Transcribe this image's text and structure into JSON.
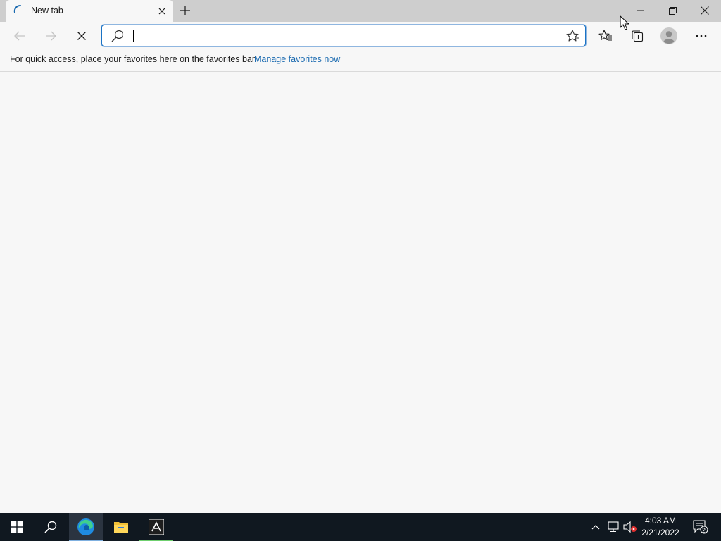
{
  "tab": {
    "title": "New tab",
    "close_icon": "close-icon",
    "favicon": "loading-spinner-icon"
  },
  "titlebar": {
    "new_tab_icon": "plus-icon",
    "minimize_icon": "minimize-icon",
    "restore_icon": "restore-icon",
    "close_icon": "close-icon"
  },
  "toolbar": {
    "back_icon": "back-arrow-icon",
    "forward_icon": "forward-arrow-icon",
    "stop_icon": "stop-icon",
    "address": {
      "value": "",
      "placeholder": ""
    },
    "favorite_icon": "star-icon",
    "favorites_icon": "favorites-icon",
    "collections_icon": "collections-icon",
    "profile_icon": "profile-avatar-icon",
    "more_icon": "more-icon"
  },
  "favorites_bar": {
    "message": "For quick access, place your favorites here on the favorites bar.",
    "link": "Manage favorites now"
  },
  "taskbar": {
    "apps": [
      "start-icon",
      "search-icon",
      "edge-icon",
      "file-explorer-icon",
      "adobe-icon"
    ],
    "tray": [
      "chevron-up-icon",
      "network-icon",
      "volume-muted-icon"
    ],
    "time": "4:03 AM",
    "date": "2/21/2022",
    "notification_count": "2"
  },
  "colors": {
    "accent": "#1a73c5",
    "taskbar": "#101820",
    "chrome": "#cecece"
  }
}
